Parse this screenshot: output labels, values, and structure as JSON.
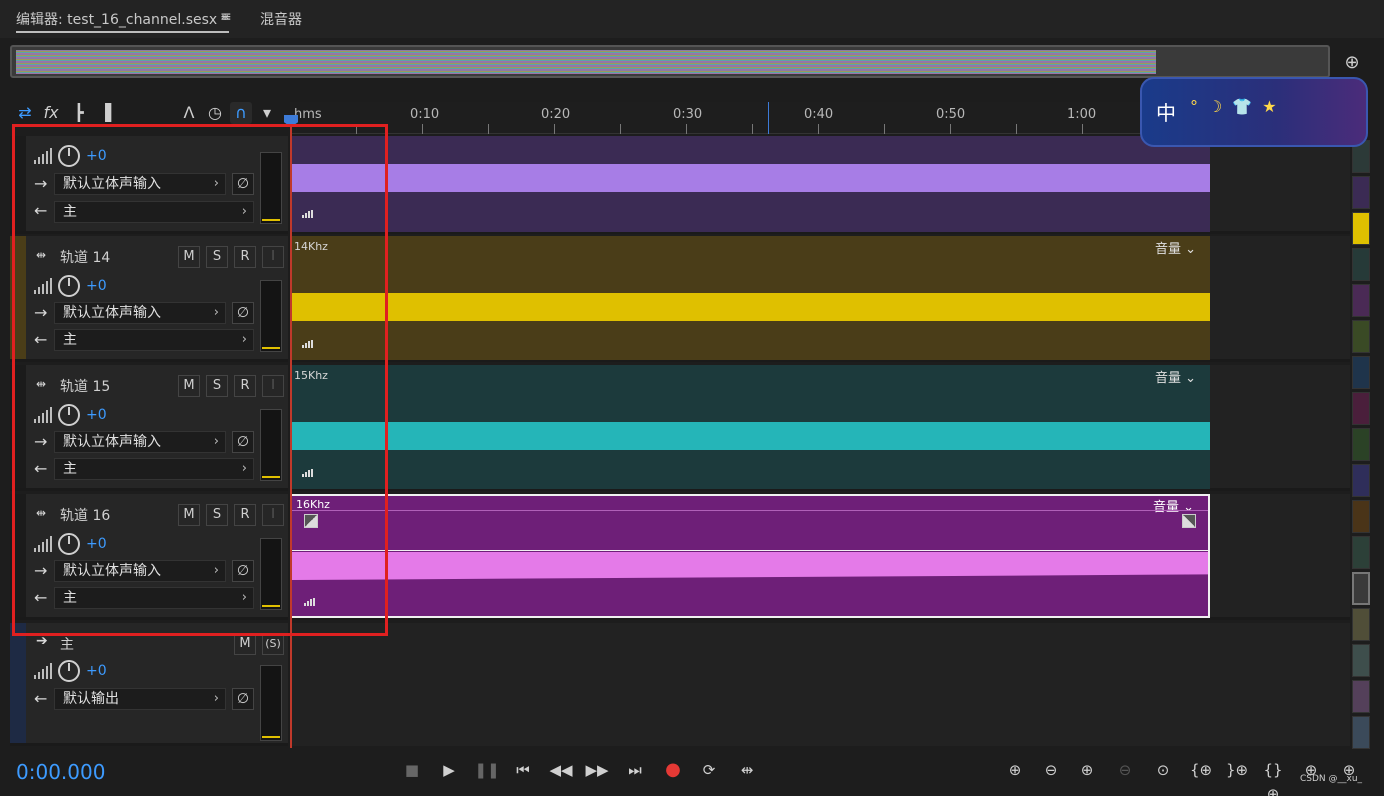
{
  "tabs": {
    "editor": "编辑器: test_16_channel.sesx *",
    "menu_icon": "≡",
    "mixer": "混音器"
  },
  "toolbar": {
    "icons": [
      "swap-icon",
      "fx-icon",
      "send-icon",
      "eq-icon",
      "tool-a-icon",
      "timer-icon",
      "snap-magnet-icon",
      "marker-icon"
    ]
  },
  "ruler": {
    "unit": "hms",
    "ticks": [
      "0:10",
      "0:20",
      "0:30",
      "0:40",
      "0:50",
      "1:00"
    ]
  },
  "tracks": [
    {
      "name": "",
      "volume": "+0",
      "input": "默认立体声输入",
      "output": "主",
      "clip_label": "",
      "clip_volume": "",
      "color": "#a77de6",
      "bg": "#3b2b54"
    },
    {
      "name": "轨道 14",
      "volume": "+0",
      "input": "默认立体声输入",
      "output": "主",
      "clip_label": "14Khz",
      "clip_volume": "音量",
      "color": "#dfc000",
      "bg": "#4a3d18"
    },
    {
      "name": "轨道 15",
      "volume": "+0",
      "input": "默认立体声输入",
      "output": "主",
      "clip_label": "15Khz",
      "clip_volume": "音量",
      "color": "#25b5b8",
      "bg": "#1c3a3c"
    },
    {
      "name": "轨道 16",
      "volume": "+0",
      "input": "默认立体声输入",
      "output": "主",
      "clip_label": "16Khz",
      "clip_volume": "音量",
      "color": "#e47ae8",
      "bg": "#6e1f78"
    }
  ],
  "buttons": {
    "mute": "M",
    "solo": "S",
    "record": "R",
    "input": "I",
    "solo_master": "(S)"
  },
  "master": {
    "name": "主",
    "volume": "+0",
    "output": "默认输出"
  },
  "transport": {
    "time": "0:00.000"
  },
  "badge": {
    "text": "中",
    "icons": "°☽👕★"
  },
  "watermark": "CSDN @__xu_",
  "colors": {
    "accent_blue": "#3d9bff",
    "record_red": "#e53935",
    "selection_red": "#e02020"
  },
  "track_colors": [
    "#2c3a38",
    "#3b2b54",
    "#dfc000",
    "#263a38",
    "#4a2a55",
    "#3a4a25",
    "#1f344b",
    "#4a1f3b",
    "#2b4226",
    "#2f2e5a",
    "#4a3418",
    "#2c4038",
    "#3a3a3a",
    "#504e38",
    "#3e4e4c",
    "#54405a",
    "#3b4a5a"
  ]
}
